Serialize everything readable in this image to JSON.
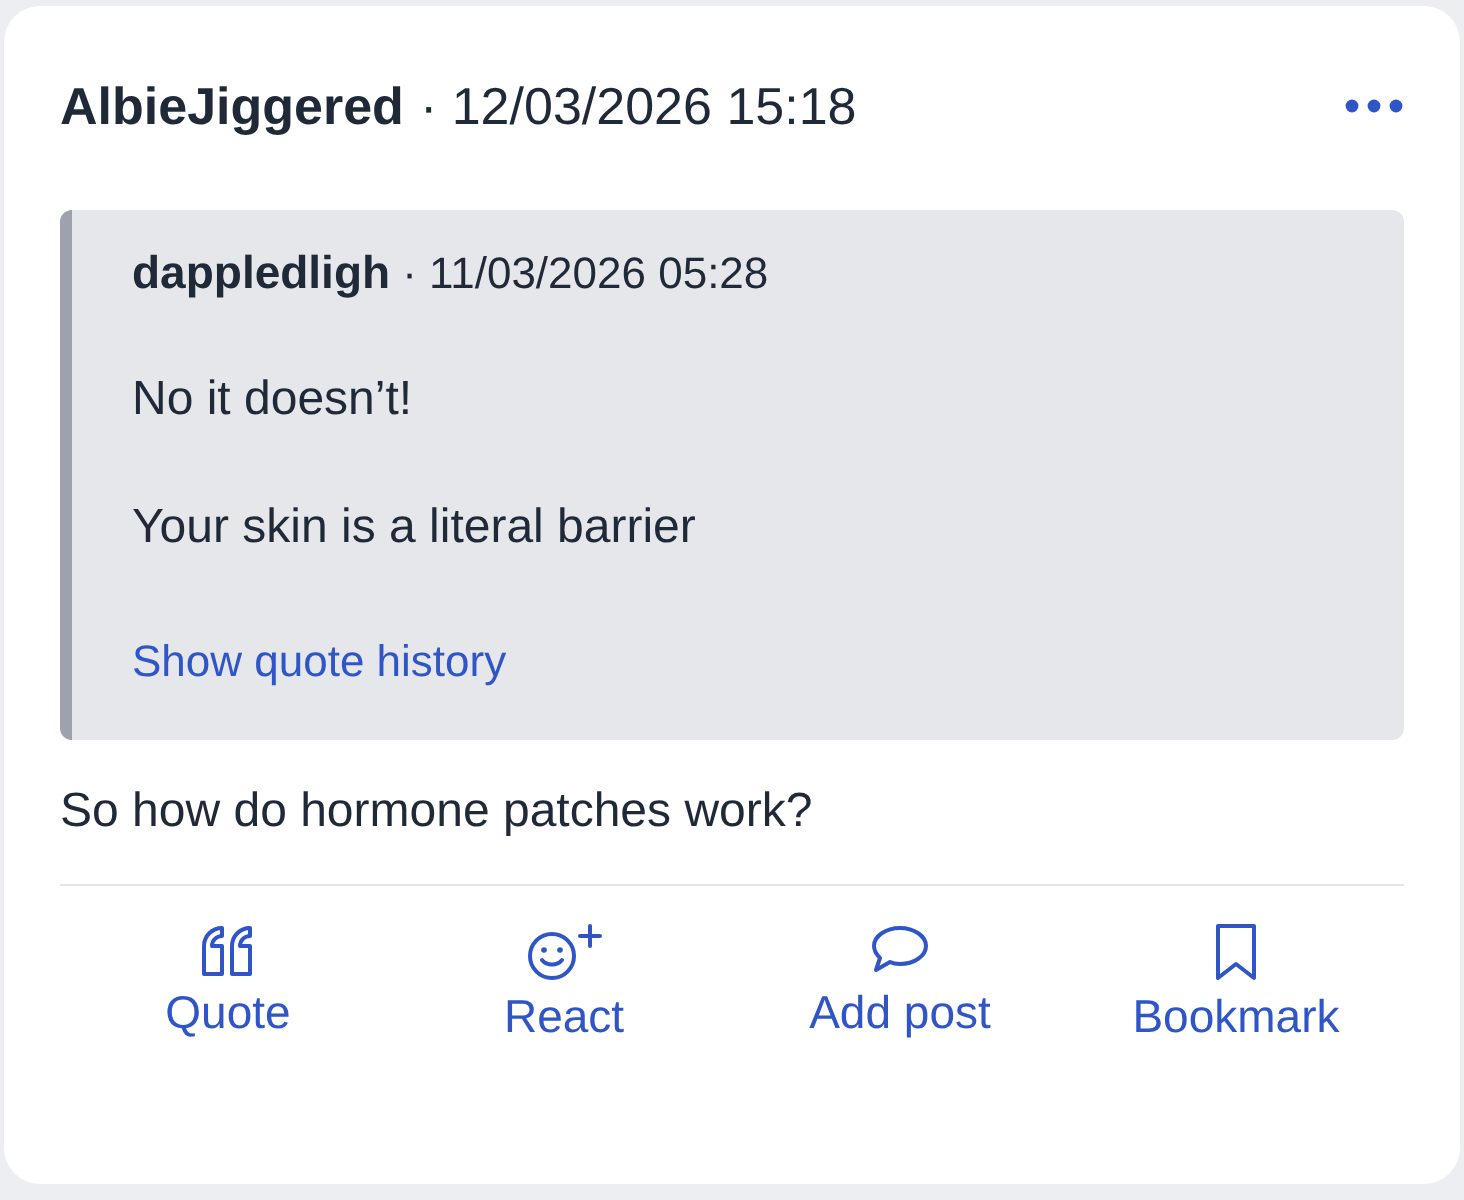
{
  "post": {
    "author": "AlbieJiggered",
    "separator": "·",
    "timestamp": "12/03/2026 15:18",
    "quote": {
      "author": "dappledligh",
      "separator": "·",
      "timestamp": "11/03/2026 05:28",
      "paragraphs": [
        "No it doesn’t!",
        "Your skin is a literal barrier"
      ],
      "history_link": "Show quote history"
    },
    "body": "So how do hormone patches work?",
    "actions": [
      {
        "kind": "quote",
        "label": "Quote"
      },
      {
        "kind": "react",
        "label": "React"
      },
      {
        "kind": "reply",
        "label": "Add post"
      },
      {
        "kind": "bookmark",
        "label": "Bookmark"
      }
    ]
  }
}
